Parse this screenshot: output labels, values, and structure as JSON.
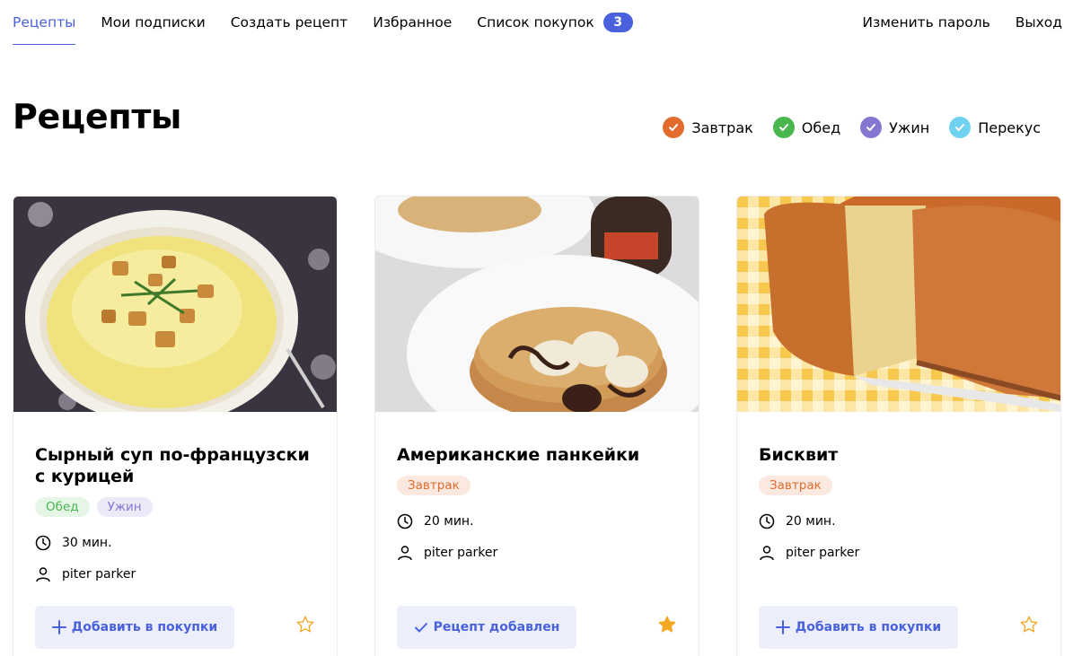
{
  "nav": {
    "items": [
      {
        "label": "Рецепты",
        "active": true
      },
      {
        "label": "Мои подписки"
      },
      {
        "label": "Создать рецепт"
      },
      {
        "label": "Избранное"
      },
      {
        "label": "Список покупок"
      }
    ],
    "cart_count": "3",
    "change_password": "Изменить пароль",
    "logout": "Выход"
  },
  "page_title": "Рецепты",
  "filters": [
    {
      "label": "Завтрак",
      "color": "#e26c2d"
    },
    {
      "label": "Обед",
      "color": "#49b64e"
    },
    {
      "label": "Ужин",
      "color": "#8775d2"
    },
    {
      "label": "Перекус",
      "color": "#70d1f0"
    }
  ],
  "cards": [
    {
      "title": "Сырный суп по-французски с курицей",
      "tags": [
        {
          "label": "Обед",
          "bg": "#e5f6e6",
          "fg": "#49b64e"
        },
        {
          "label": "Ужин",
          "bg": "#ece9f8",
          "fg": "#8775d2"
        }
      ],
      "time": "30 мин.",
      "author": "piter parker",
      "button_label": "Добавить в покупки",
      "button_icon": "plus-icon",
      "favorited": false
    },
    {
      "title": "Американские панкейки",
      "tags": [
        {
          "label": "Завтрак",
          "bg": "#fbe9e0",
          "fg": "#e26c2d"
        }
      ],
      "time": "20 мин.",
      "author": "piter parker",
      "button_label": "Рецепт добавлен",
      "button_icon": "check-icon",
      "favorited": true
    },
    {
      "title": "Бисквит",
      "tags": [
        {
          "label": "Завтрак",
          "bg": "#fbe9e0",
          "fg": "#e26c2d"
        }
      ],
      "time": "20 мин.",
      "author": "piter parker",
      "button_label": "Добавить в покупки",
      "button_icon": "plus-icon",
      "favorited": false
    }
  ],
  "colors": {
    "accent": "#4a61dd",
    "star": "#f5a623"
  }
}
